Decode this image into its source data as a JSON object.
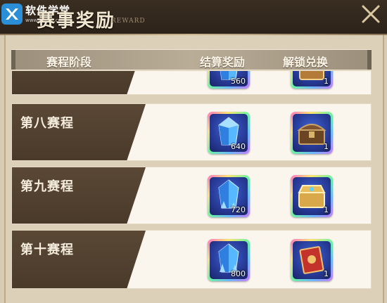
{
  "watermark": {
    "title": "软件学堂",
    "url": "www.xue51.com"
  },
  "header": {
    "title": "赛事奖励",
    "subtitle": "REWARD"
  },
  "columns": {
    "stage": "赛程阶段",
    "reward": "结算奖励",
    "unlock": "解锁兑换"
  },
  "rows": [
    {
      "stage": "",
      "reward_qty": "560",
      "unlock_qty": "1",
      "unlock_icon": "treasure-chest-icon"
    },
    {
      "stage": "第八赛程",
      "reward_qty": "640",
      "unlock_qty": "1",
      "unlock_icon": "wooden-chest-icon"
    },
    {
      "stage": "第九赛程",
      "reward_qty": "720",
      "unlock_qty": "1",
      "unlock_icon": "gold-chest-icon"
    },
    {
      "stage": "第十赛程",
      "reward_qty": "800",
      "unlock_qty": "1",
      "unlock_icon": "red-book-icon"
    }
  ],
  "colors": {
    "header_bg": "#2c2219",
    "stage_bg": "#4a3a2a",
    "row_bg": "#faf6ee",
    "accent": "#c9b48e"
  }
}
